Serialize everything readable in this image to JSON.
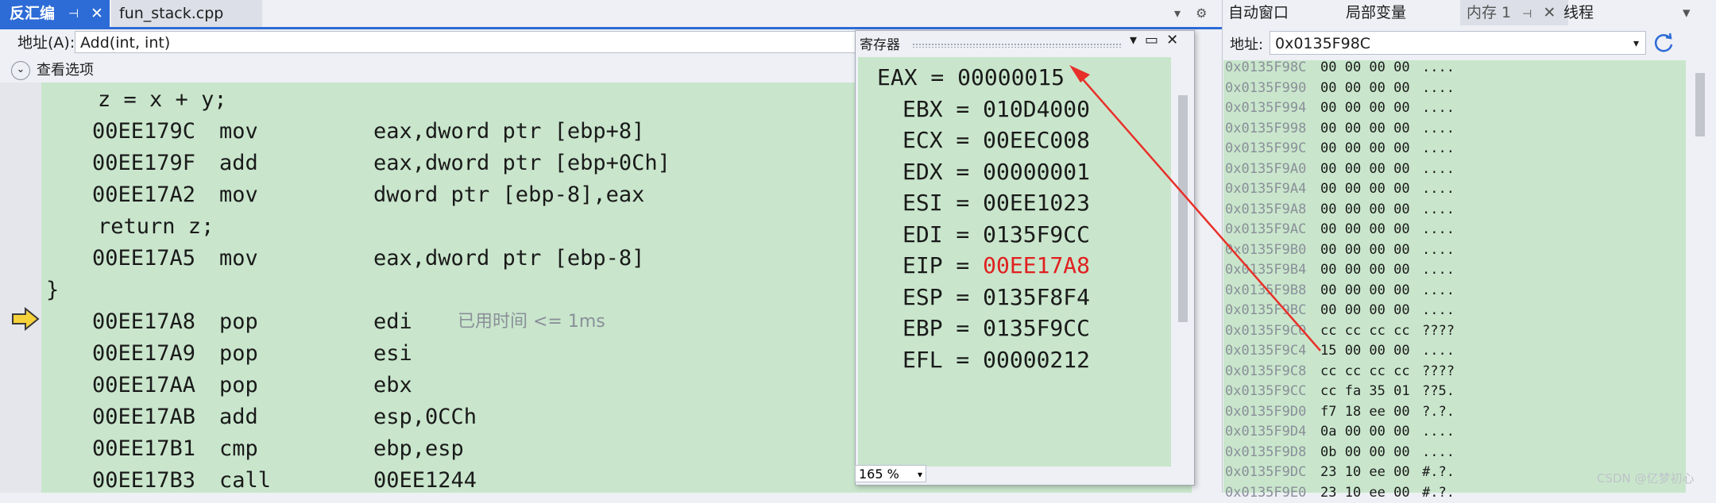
{
  "left_panel": {
    "tab_active": "反汇编",
    "tab_file": "fun_stack.cpp",
    "address_label": "地址(A):",
    "address_value": "Add(int, int)",
    "view_options": "查看选项",
    "elapsed": "已用时间 <= 1ms",
    "lines": [
      {
        "src": "    z = x + y;"
      },
      {
        "addr": "00EE179C",
        "op": "mov",
        "arg": "eax,dword ptr [ebp+8]"
      },
      {
        "addr": "00EE179F",
        "op": "add",
        "arg": "eax,dword ptr [ebp+0Ch]"
      },
      {
        "addr": "00EE17A2",
        "op": "mov",
        "arg": "dword ptr [ebp-8],eax"
      },
      {
        "src": "    return z;"
      },
      {
        "addr": "00EE17A5",
        "op": "mov",
        "arg": "eax,dword ptr [ebp-8]"
      },
      {
        "src": "}"
      },
      {
        "addr": "00EE17A8",
        "op": "pop",
        "arg": "edi"
      },
      {
        "addr": "00EE17A9",
        "op": "pop",
        "arg": "esi"
      },
      {
        "addr": "00EE17AA",
        "op": "pop",
        "arg": "ebx"
      },
      {
        "addr": "00EE17AB",
        "op": "add",
        "arg": "esp,0CCh"
      },
      {
        "addr": "00EE17B1",
        "op": "cmp",
        "arg": "ebp,esp"
      },
      {
        "addr": "00EE17B3",
        "op": "call",
        "arg": "00EE1244"
      }
    ]
  },
  "registers_window": {
    "title": "寄存器",
    "zoom": "165 %",
    "registers": [
      {
        "text": "EAX = 00000015"
      },
      {
        "text": "EBX = 010D4000"
      },
      {
        "text": "ECX = 00EEC008"
      },
      {
        "text": "EDX = 00000001"
      },
      {
        "text": "ESI = 00EE1023"
      },
      {
        "text": "EDI = 0135F9CC"
      },
      {
        "name": "EIP = ",
        "value": "00EE17A8"
      },
      {
        "text": "ESP = 0135F8F4"
      },
      {
        "text": "EBP = 0135F9CC"
      },
      {
        "text": "EFL = 00000212"
      }
    ],
    "changed_color": "#e02020"
  },
  "right_panel": {
    "tabs": [
      "自动窗口",
      "局部变量",
      "内存 1",
      "线程"
    ],
    "address_label": "地址:",
    "address_value": "0x0135F98C",
    "rows": [
      [
        "0x0135F98C",
        "00 00 00 00",
        "...."
      ],
      [
        "0x0135F990",
        "00 00 00 00",
        "...."
      ],
      [
        "0x0135F994",
        "00 00 00 00",
        "...."
      ],
      [
        "0x0135F998",
        "00 00 00 00",
        "...."
      ],
      [
        "0x0135F99C",
        "00 00 00 00",
        "...."
      ],
      [
        "0x0135F9A0",
        "00 00 00 00",
        "...."
      ],
      [
        "0x0135F9A4",
        "00 00 00 00",
        "...."
      ],
      [
        "0x0135F9A8",
        "00 00 00 00",
        "...."
      ],
      [
        "0x0135F9AC",
        "00 00 00 00",
        "...."
      ],
      [
        "0x0135F9B0",
        "00 00 00 00",
        "...."
      ],
      [
        "0x0135F9B4",
        "00 00 00 00",
        "...."
      ],
      [
        "0x0135F9B8",
        "00 00 00 00",
        "...."
      ],
      [
        "0x0135F9BC",
        "00 00 00 00",
        "...."
      ],
      [
        "0x0135F9C0",
        "cc cc cc cc",
        "????"
      ],
      [
        "0x0135F9C4",
        "15 00 00 00",
        "...."
      ],
      [
        "0x0135F9C8",
        "cc cc cc cc",
        "????"
      ],
      [
        "0x0135F9CC",
        "cc fa 35 01",
        "??5."
      ],
      [
        "0x0135F9D0",
        "f7 18 ee 00",
        "?.?."
      ],
      [
        "0x0135F9D4",
        "0a 00 00 00",
        "...."
      ],
      [
        "0x0135F9D8",
        "0b 00 00 00",
        "...."
      ],
      [
        "0x0135F9DC",
        "23 10 ee 00",
        "#.?."
      ],
      [
        "0x0135F9E0",
        "23 10 ee 00",
        "#.?."
      ]
    ]
  },
  "watermark": "CSDN @亿梦初心",
  "annotation_color": "#e8302a"
}
